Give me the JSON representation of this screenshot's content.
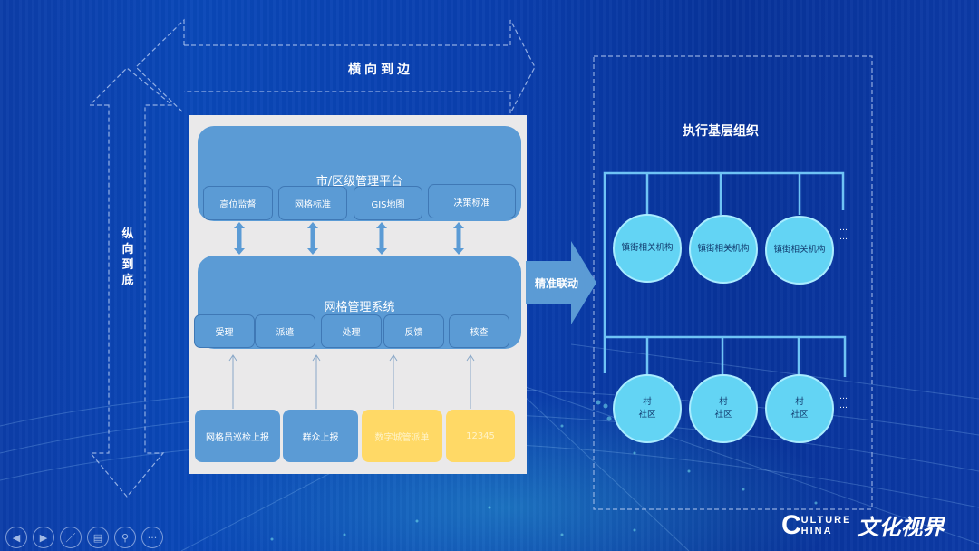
{
  "labels": {
    "horizontal": "横向到边",
    "vertical": "纵向到底",
    "link": "精准联动"
  },
  "platform": {
    "title": "市/区级管理平台",
    "items": [
      "高位监督",
      "网格标准",
      "GIS地图",
      "决策标准"
    ]
  },
  "system": {
    "title": "网格管理系统",
    "items": [
      "受理",
      "派遣",
      "处理",
      "反馈",
      "核查"
    ]
  },
  "sources": [
    {
      "label": "网格员巡检上报",
      "color": "#5b9bd5"
    },
    {
      "label": "群众上报",
      "color": "#5b9bd5"
    },
    {
      "label": "数字城管派单",
      "color": "#ffd966"
    },
    {
      "label": "12345",
      "color": "#ffd966"
    }
  ],
  "execution": {
    "title": "执行基层组织",
    "street_nodes": [
      "镇街相关机构",
      "镇街相关机构",
      "镇街相关机构"
    ],
    "community_nodes": [
      "村\n社区",
      "村\n社区",
      "村\n社区"
    ],
    "more": "…\n…"
  },
  "toolbar": {
    "buttons": [
      {
        "name": "previous-slide-button",
        "icon": "◀"
      },
      {
        "name": "next-slide-button",
        "icon": "▶"
      },
      {
        "name": "pen-button",
        "icon": "／"
      },
      {
        "name": "slides-overview-button",
        "icon": "▤"
      },
      {
        "name": "zoom-button",
        "icon": "⚲"
      },
      {
        "name": "more-options-button",
        "icon": "···"
      }
    ]
  },
  "logo": {
    "letter": "C",
    "line1": "ULTURE",
    "line2": "HINA",
    "chinese": "文化视界"
  },
  "colors": {
    "background": "#0a40ae",
    "panel": "#eae9ea",
    "box_blue": "#5b9bd5",
    "box_yellow": "#ffd966",
    "node_cyan": "#63d4f4",
    "tree_line": "#6fc3f5"
  }
}
